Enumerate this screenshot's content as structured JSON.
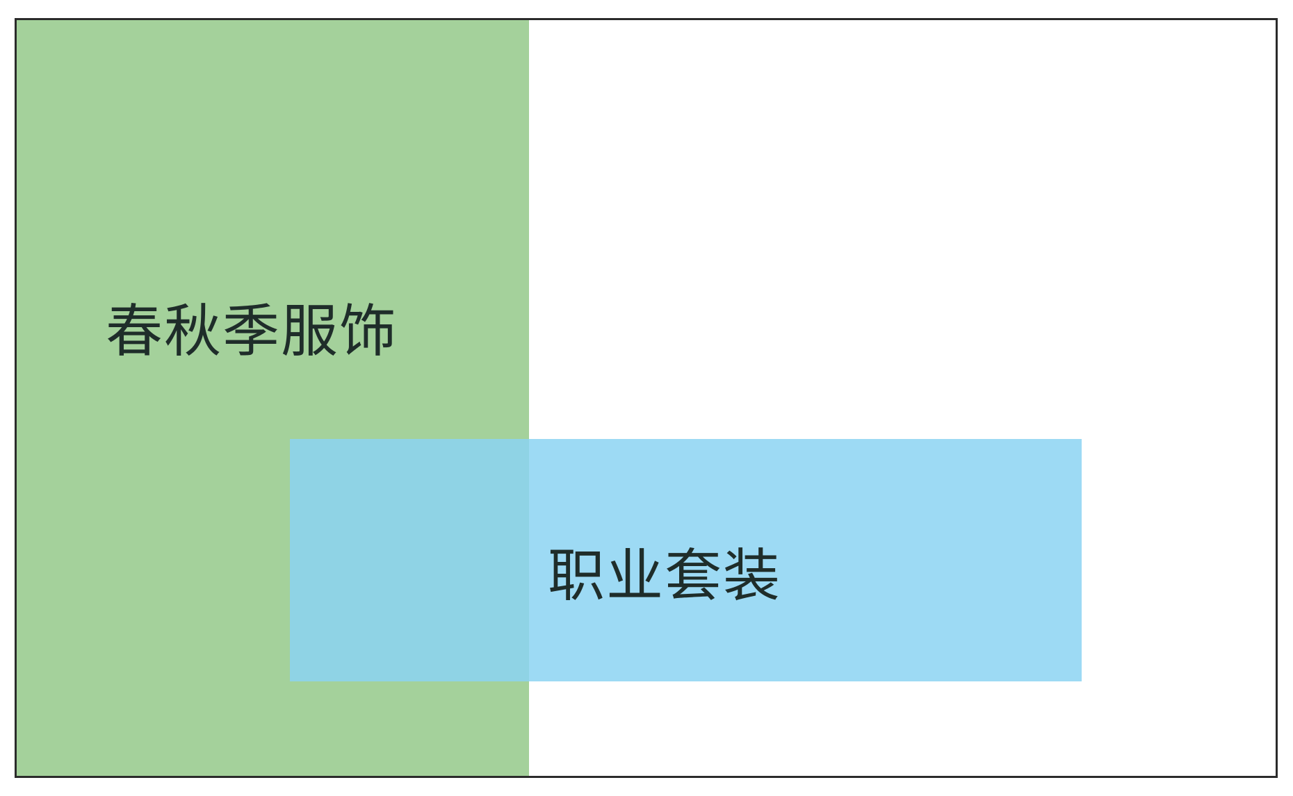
{
  "diagram": {
    "regions": [
      {
        "label": "春秋季服饰",
        "color": "#a4d19b"
      },
      {
        "label": "职业套装",
        "color": "#8cd4f2"
      }
    ],
    "overlap_color": "#79cdc7",
    "border_color": "#2b2b2b"
  }
}
